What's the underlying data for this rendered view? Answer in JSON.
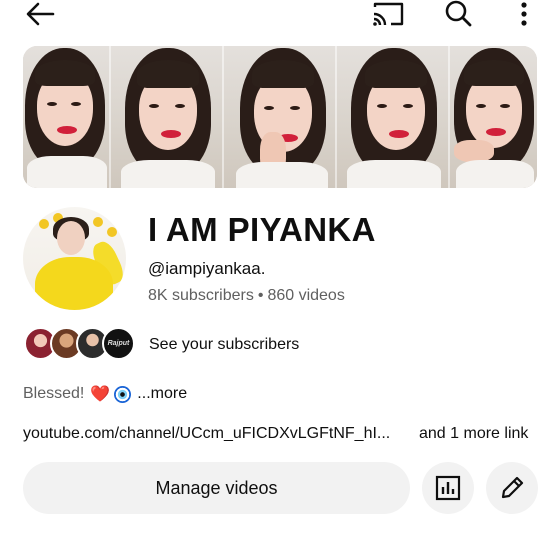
{
  "topbar": {
    "icons": [
      "back-arrow-icon",
      "cast-icon",
      "search-icon",
      "more-vert-icon"
    ]
  },
  "channel": {
    "name": "I AM PIYANKA",
    "handle": "@iampiyankaa.",
    "subscribers": "8K subscribers",
    "separator": "•",
    "videos": "860 videos"
  },
  "subscribers_row": {
    "label": "See your subscribers",
    "avatar_4_text": "Rajput"
  },
  "description": {
    "text": "Blessed!",
    "heart": "❤️",
    "more": "...more"
  },
  "links": {
    "url": "youtube.com/channel/UCcm_uFICDXvLGFtNF_hI...",
    "extra": "and 1 more link"
  },
  "actions": {
    "manage_label": "Manage videos",
    "analytics_icon": "analytics-icon",
    "edit_icon": "pencil-icon"
  },
  "colors": {
    "secondary_text": "#606060",
    "button_bg": "#f2f2f2",
    "avatar_yellow": "#f4d81c"
  }
}
